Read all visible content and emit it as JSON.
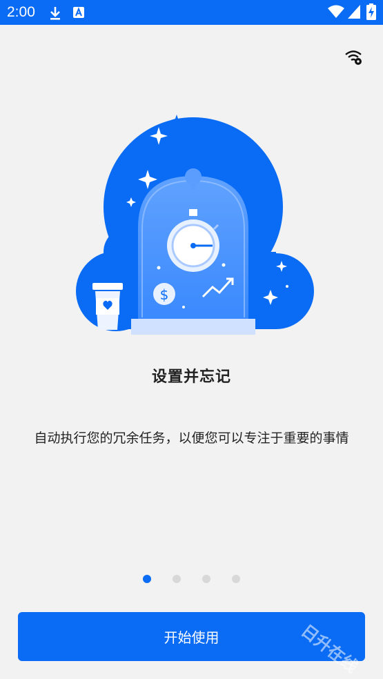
{
  "status_bar": {
    "time": "2:00",
    "icons": [
      "download-icon",
      "a-letter-icon",
      "wifi-icon",
      "signal-icon",
      "battery-charging-icon"
    ]
  },
  "top": {
    "icon": "wifi-settings-icon"
  },
  "onboarding": {
    "title": "设置并忘记",
    "description": "自动执行您的冗余任务，以便您可以专注于重要的事情",
    "page_count": 4,
    "current_page": 1
  },
  "start_button": {
    "label": "开始使用"
  },
  "watermark": {
    "text": "日升在线"
  },
  "colors": {
    "primary": "#0a6cf5",
    "background": "#f2f2f2",
    "text": "#222222"
  }
}
